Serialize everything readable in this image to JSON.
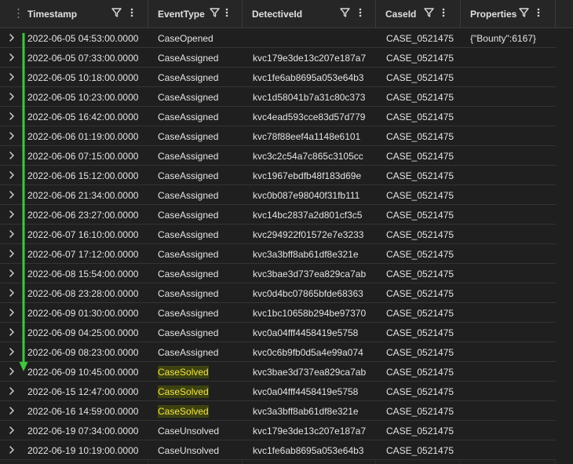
{
  "columns": [
    {
      "key": "timestamp",
      "label": "Timestamp"
    },
    {
      "key": "event_type",
      "label": "EventType"
    },
    {
      "key": "detective_id",
      "label": "DetectiveId"
    },
    {
      "key": "case_id",
      "label": "CaseId"
    },
    {
      "key": "properties",
      "label": "Properties"
    }
  ],
  "rows": [
    {
      "timestamp": "2022-06-05 04:53:00.0000",
      "event_type": "CaseOpened",
      "detective_id": "",
      "case_id": "CASE_0521475",
      "properties": "{\"Bounty\":6167}"
    },
    {
      "timestamp": "2022-06-05 07:33:00.0000",
      "event_type": "CaseAssigned",
      "detective_id": "kvc179e3de13c207e187a7",
      "case_id": "CASE_0521475",
      "properties": ""
    },
    {
      "timestamp": "2022-06-05 10:18:00.0000",
      "event_type": "CaseAssigned",
      "detective_id": "kvc1fe6ab8695a053e64b3",
      "case_id": "CASE_0521475",
      "properties": ""
    },
    {
      "timestamp": "2022-06-05 10:23:00.0000",
      "event_type": "CaseAssigned",
      "detective_id": "kvc1d58041b7a31c80c373",
      "case_id": "CASE_0521475",
      "properties": ""
    },
    {
      "timestamp": "2022-06-05 16:42:00.0000",
      "event_type": "CaseAssigned",
      "detective_id": "kvc4ead593cce83d57d779",
      "case_id": "CASE_0521475",
      "properties": ""
    },
    {
      "timestamp": "2022-06-06 01:19:00.0000",
      "event_type": "CaseAssigned",
      "detective_id": "kvc78f88eef4a1148e6101",
      "case_id": "CASE_0521475",
      "properties": ""
    },
    {
      "timestamp": "2022-06-06 07:15:00.0000",
      "event_type": "CaseAssigned",
      "detective_id": "kvc3c2c54a7c865c3105cc",
      "case_id": "CASE_0521475",
      "properties": ""
    },
    {
      "timestamp": "2022-06-06 15:12:00.0000",
      "event_type": "CaseAssigned",
      "detective_id": "kvc1967ebdfb48f183d69e",
      "case_id": "CASE_0521475",
      "properties": ""
    },
    {
      "timestamp": "2022-06-06 21:34:00.0000",
      "event_type": "CaseAssigned",
      "detective_id": "kvc0b087e98040f31fb111",
      "case_id": "CASE_0521475",
      "properties": ""
    },
    {
      "timestamp": "2022-06-06 23:27:00.0000",
      "event_type": "CaseAssigned",
      "detective_id": "kvc14bc2837a2d801cf3c5",
      "case_id": "CASE_0521475",
      "properties": ""
    },
    {
      "timestamp": "2022-06-07 16:10:00.0000",
      "event_type": "CaseAssigned",
      "detective_id": "kvc294922f01572e7e3233",
      "case_id": "CASE_0521475",
      "properties": ""
    },
    {
      "timestamp": "2022-06-07 17:12:00.0000",
      "event_type": "CaseAssigned",
      "detective_id": "kvc3a3bff8ab61df8e321e",
      "case_id": "CASE_0521475",
      "properties": ""
    },
    {
      "timestamp": "2022-06-08 15:54:00.0000",
      "event_type": "CaseAssigned",
      "detective_id": "kvc3bae3d737ea829ca7ab",
      "case_id": "CASE_0521475",
      "properties": ""
    },
    {
      "timestamp": "2022-06-08 23:28:00.0000",
      "event_type": "CaseAssigned",
      "detective_id": "kvc0d4bc07865bfde68363",
      "case_id": "CASE_0521475",
      "properties": ""
    },
    {
      "timestamp": "2022-06-09 01:30:00.0000",
      "event_type": "CaseAssigned",
      "detective_id": "kvc1bc10658b294be97370",
      "case_id": "CASE_0521475",
      "properties": ""
    },
    {
      "timestamp": "2022-06-09 04:25:00.0000",
      "event_type": "CaseAssigned",
      "detective_id": "kvc0a04fff4458419e5758",
      "case_id": "CASE_0521475",
      "properties": ""
    },
    {
      "timestamp": "2022-06-09 08:23:00.0000",
      "event_type": "CaseAssigned",
      "detective_id": "kvc0c6b9fb0d5a4e99a074",
      "case_id": "CASE_0521475",
      "properties": ""
    },
    {
      "timestamp": "2022-06-09 10:45:00.0000",
      "event_type": "CaseSolved",
      "detective_id": "kvc3bae3d737ea829ca7ab",
      "case_id": "CASE_0521475",
      "properties": "",
      "highlight": true
    },
    {
      "timestamp": "2022-06-15 12:47:00.0000",
      "event_type": "CaseSolved",
      "detective_id": "kvc0a04fff4458419e5758",
      "case_id": "CASE_0521475",
      "properties": "",
      "highlight": true
    },
    {
      "timestamp": "2022-06-16 14:59:00.0000",
      "event_type": "CaseSolved",
      "detective_id": "kvc3a3bff8ab61df8e321e",
      "case_id": "CASE_0521475",
      "properties": "",
      "highlight": true
    },
    {
      "timestamp": "2022-06-19 07:34:00.0000",
      "event_type": "CaseUnsolved",
      "detective_id": "kvc179e3de13c207e187a7",
      "case_id": "CASE_0521475",
      "properties": ""
    },
    {
      "timestamp": "2022-06-19 10:19:00.0000",
      "event_type": "CaseUnsolved",
      "detective_id": "kvc1fe6ab8695a053e64b3",
      "case_id": "CASE_0521475",
      "properties": ""
    }
  ],
  "colors": {
    "background": "#1f1f1f",
    "header_bg": "#262626",
    "highlight_bg": "#3d4210",
    "highlight_text": "#f0e24a",
    "arrow": "#3fc73f"
  },
  "icons": {
    "expander": "chevron-right-icon",
    "filter": "filter-icon",
    "menu": "more-vertical-icon",
    "drag": "drag-handle-icon",
    "annotation": "green-down-arrow"
  }
}
